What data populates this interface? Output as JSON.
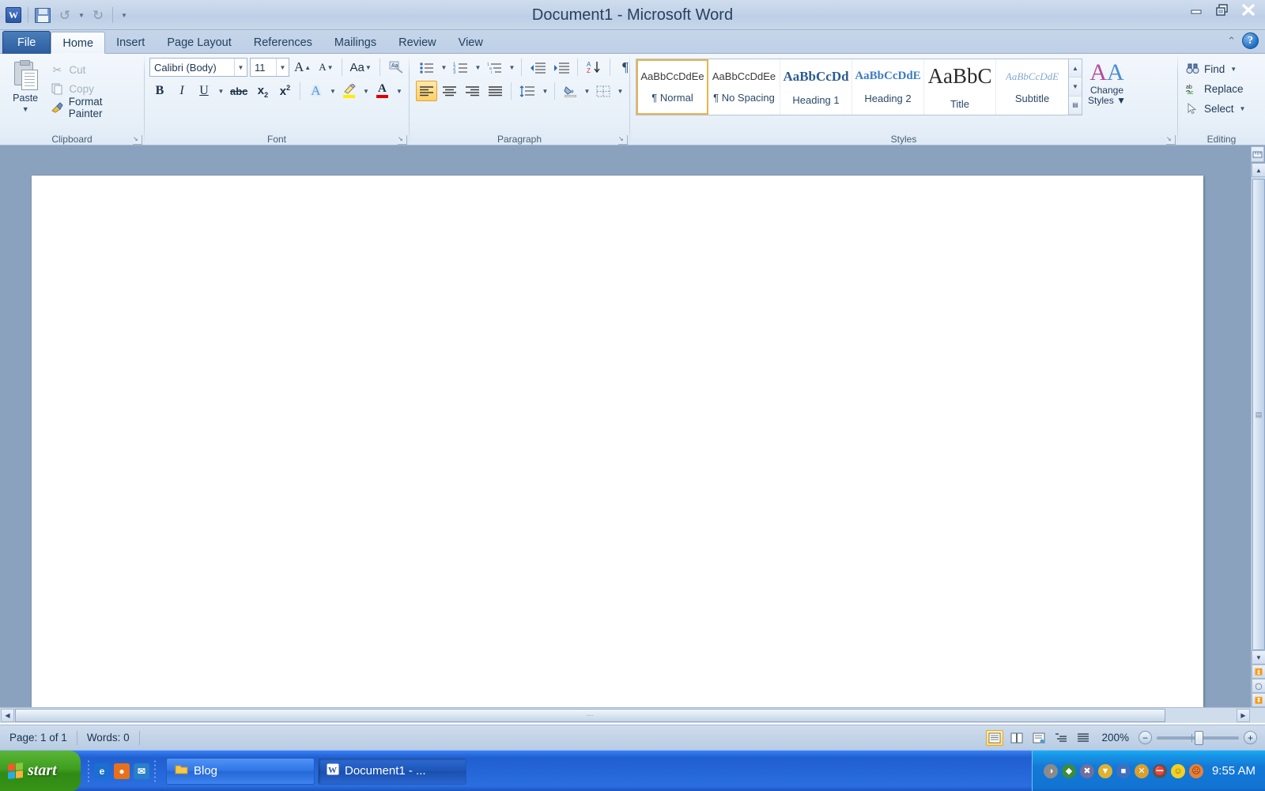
{
  "window": {
    "title": "Document1  -  Microsoft Word",
    "minimize_label": "Minimize",
    "restore_label": "Restore",
    "close_label": "Close"
  },
  "quick_access": {
    "word_logo": "W",
    "save_label": "Save",
    "undo_label": "Undo",
    "redo_label": "Redo",
    "customize_label": "Customize Quick Access Toolbar"
  },
  "ribbon": {
    "collapse_label": "Minimize the Ribbon",
    "help_label": "?",
    "tabs": [
      {
        "label": "File",
        "kind": "file"
      },
      {
        "label": "Home",
        "kind": "active"
      },
      {
        "label": "Insert",
        "kind": "normal"
      },
      {
        "label": "Page Layout",
        "kind": "normal"
      },
      {
        "label": "References",
        "kind": "normal"
      },
      {
        "label": "Mailings",
        "kind": "normal"
      },
      {
        "label": "Review",
        "kind": "normal"
      },
      {
        "label": "View",
        "kind": "normal"
      }
    ],
    "clipboard": {
      "group_label": "Clipboard",
      "paste_label": "Paste",
      "cut_label": "Cut",
      "copy_label": "Copy",
      "format_painter_label": "Format Painter"
    },
    "font": {
      "group_label": "Font",
      "font_name": "Calibri (Body)",
      "font_size": "11",
      "grow_font_label": "Grow Font",
      "shrink_font_label": "Shrink Font",
      "change_case_label": "Aa",
      "clear_formatting_label": "Clear Formatting",
      "bold_label": "B",
      "italic_label": "I",
      "underline_label": "U",
      "strikethrough_label": "abc",
      "subscript_label": "x",
      "subscript_sub": "2",
      "superscript_label": "x",
      "superscript_sup": "2",
      "text_effects_label": "A",
      "highlight_label": "Text Highlight Color",
      "highlight_color": "#ffed00",
      "font_color_label": "A",
      "font_color": "#e00000"
    },
    "paragraph": {
      "group_label": "Paragraph",
      "bullets_label": "Bullets",
      "numbering_label": "Numbering",
      "multilevel_label": "Multilevel List",
      "decrease_indent_label": "Decrease Indent",
      "increase_indent_label": "Increase Indent",
      "sort_label": "Sort",
      "show_marks_label": "¶",
      "align_left_label": "Align Text Left",
      "center_label": "Center",
      "align_right_label": "Align Text Right",
      "justify_label": "Justify",
      "line_spacing_label": "Line and Paragraph Spacing",
      "shading_label": "Shading",
      "borders_label": "Borders"
    },
    "styles": {
      "group_label": "Styles",
      "items": [
        {
          "preview": "AaBbCcDdEe",
          "name": "¶ Normal",
          "selected": true
        },
        {
          "preview": "AaBbCcDdEe",
          "name": "¶ No Spacing",
          "selected": false
        },
        {
          "preview": "AaBbCcDd",
          "name": "Heading 1",
          "selected": false
        },
        {
          "preview": "AaBbCcDdE",
          "name": "Heading 2",
          "selected": false
        },
        {
          "preview": "AaBbC",
          "name": "Title",
          "selected": false
        },
        {
          "preview": "AaBbCcDdE",
          "name": "Subtitle",
          "selected": false
        }
      ],
      "change_styles_line1": "Change",
      "change_styles_line2": "Styles"
    },
    "editing": {
      "group_label": "Editing",
      "find_label": "Find",
      "replace_label": "Replace",
      "select_label": "Select",
      "replace_icon_top": "ab",
      "replace_icon_bottom": "ac"
    }
  },
  "status": {
    "page_label": "Page: 1 of 1",
    "words_label": "Words: 0",
    "zoom_label": "200%",
    "zoom_out_label": "−",
    "zoom_in_label": "+",
    "views": [
      {
        "name": "print-layout",
        "selected": true
      },
      {
        "name": "full-screen-reading",
        "selected": false
      },
      {
        "name": "web-layout",
        "selected": false
      },
      {
        "name": "outline",
        "selected": false
      },
      {
        "name": "draft",
        "selected": false
      }
    ]
  },
  "taskbar": {
    "start_label": "start",
    "quicklaunch": [
      {
        "name": "internet-explorer-icon",
        "glyph": "e",
        "color": "#1a6fd0"
      },
      {
        "name": "firefox-icon",
        "glyph": "●",
        "color": "#e8701a"
      },
      {
        "name": "outlook-express-icon",
        "glyph": "✉",
        "color": "#2a7fc9"
      }
    ],
    "tasks": [
      {
        "label": "Blog",
        "icon": "folder-icon",
        "active": false
      },
      {
        "label": "Document1 - ...",
        "icon": "word-icon",
        "active": true
      }
    ],
    "tray": [
      {
        "name": "tray-icon-1",
        "glyph": "◑",
        "color": "#8a8a8a"
      },
      {
        "name": "tray-icon-2",
        "glyph": "◆",
        "color": "#3b8c3b"
      },
      {
        "name": "tray-icon-3",
        "glyph": "✖",
        "color": "#6f6f9f"
      },
      {
        "name": "tray-icon-4",
        "glyph": "▼",
        "color": "#e0b030"
      },
      {
        "name": "tray-icon-5",
        "glyph": "■",
        "color": "#3f6fbf"
      },
      {
        "name": "tray-icon-6",
        "glyph": "✕",
        "color": "#d8a030"
      },
      {
        "name": "tray-icon-7",
        "glyph": "⛔",
        "color": "#555555"
      },
      {
        "name": "tray-icon-smile",
        "glyph": "☺",
        "color": "#f2d024"
      },
      {
        "name": "tray-icon-frown",
        "glyph": "☹",
        "color": "#e8803a"
      }
    ],
    "clock": "9:55 AM"
  },
  "document": {
    "content": ""
  }
}
